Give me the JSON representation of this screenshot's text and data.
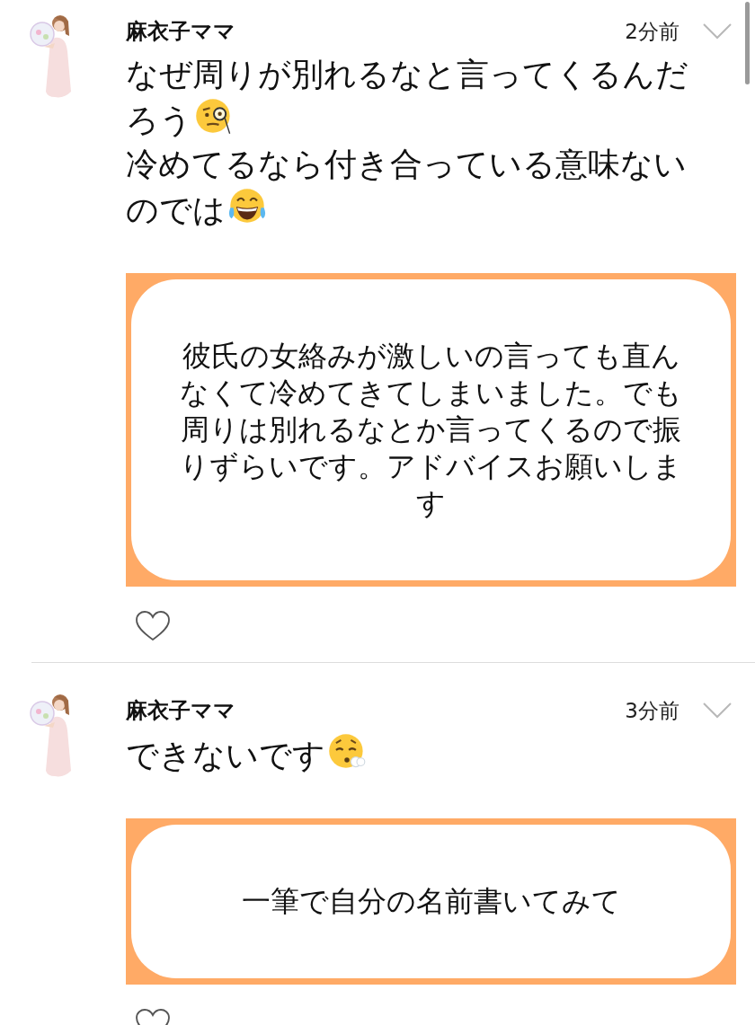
{
  "posts": [
    {
      "author": "麻衣子ママ",
      "time": "2分前",
      "body": [
        {
          "text": "なぜ周りが別れるなと言ってくるんだろう",
          "kind": "monocle"
        },
        {
          "text": "冷めてるなら付き合っている意味ないのでは",
          "kind": "laugh"
        }
      ],
      "quote": "彼氏の女絡みが激しいの言っても直んなくて冷めてきてしまいました。でも周りは別れるなとか言ってくるので振りずらいです。アドバイスお願いします",
      "liked": false
    },
    {
      "author": "麻衣子ママ",
      "time": "3分前",
      "body": [
        {
          "text": "できないです",
          "kind": "sigh"
        }
      ],
      "quote": "一筆で自分の名前書いてみて",
      "liked": false
    }
  ]
}
